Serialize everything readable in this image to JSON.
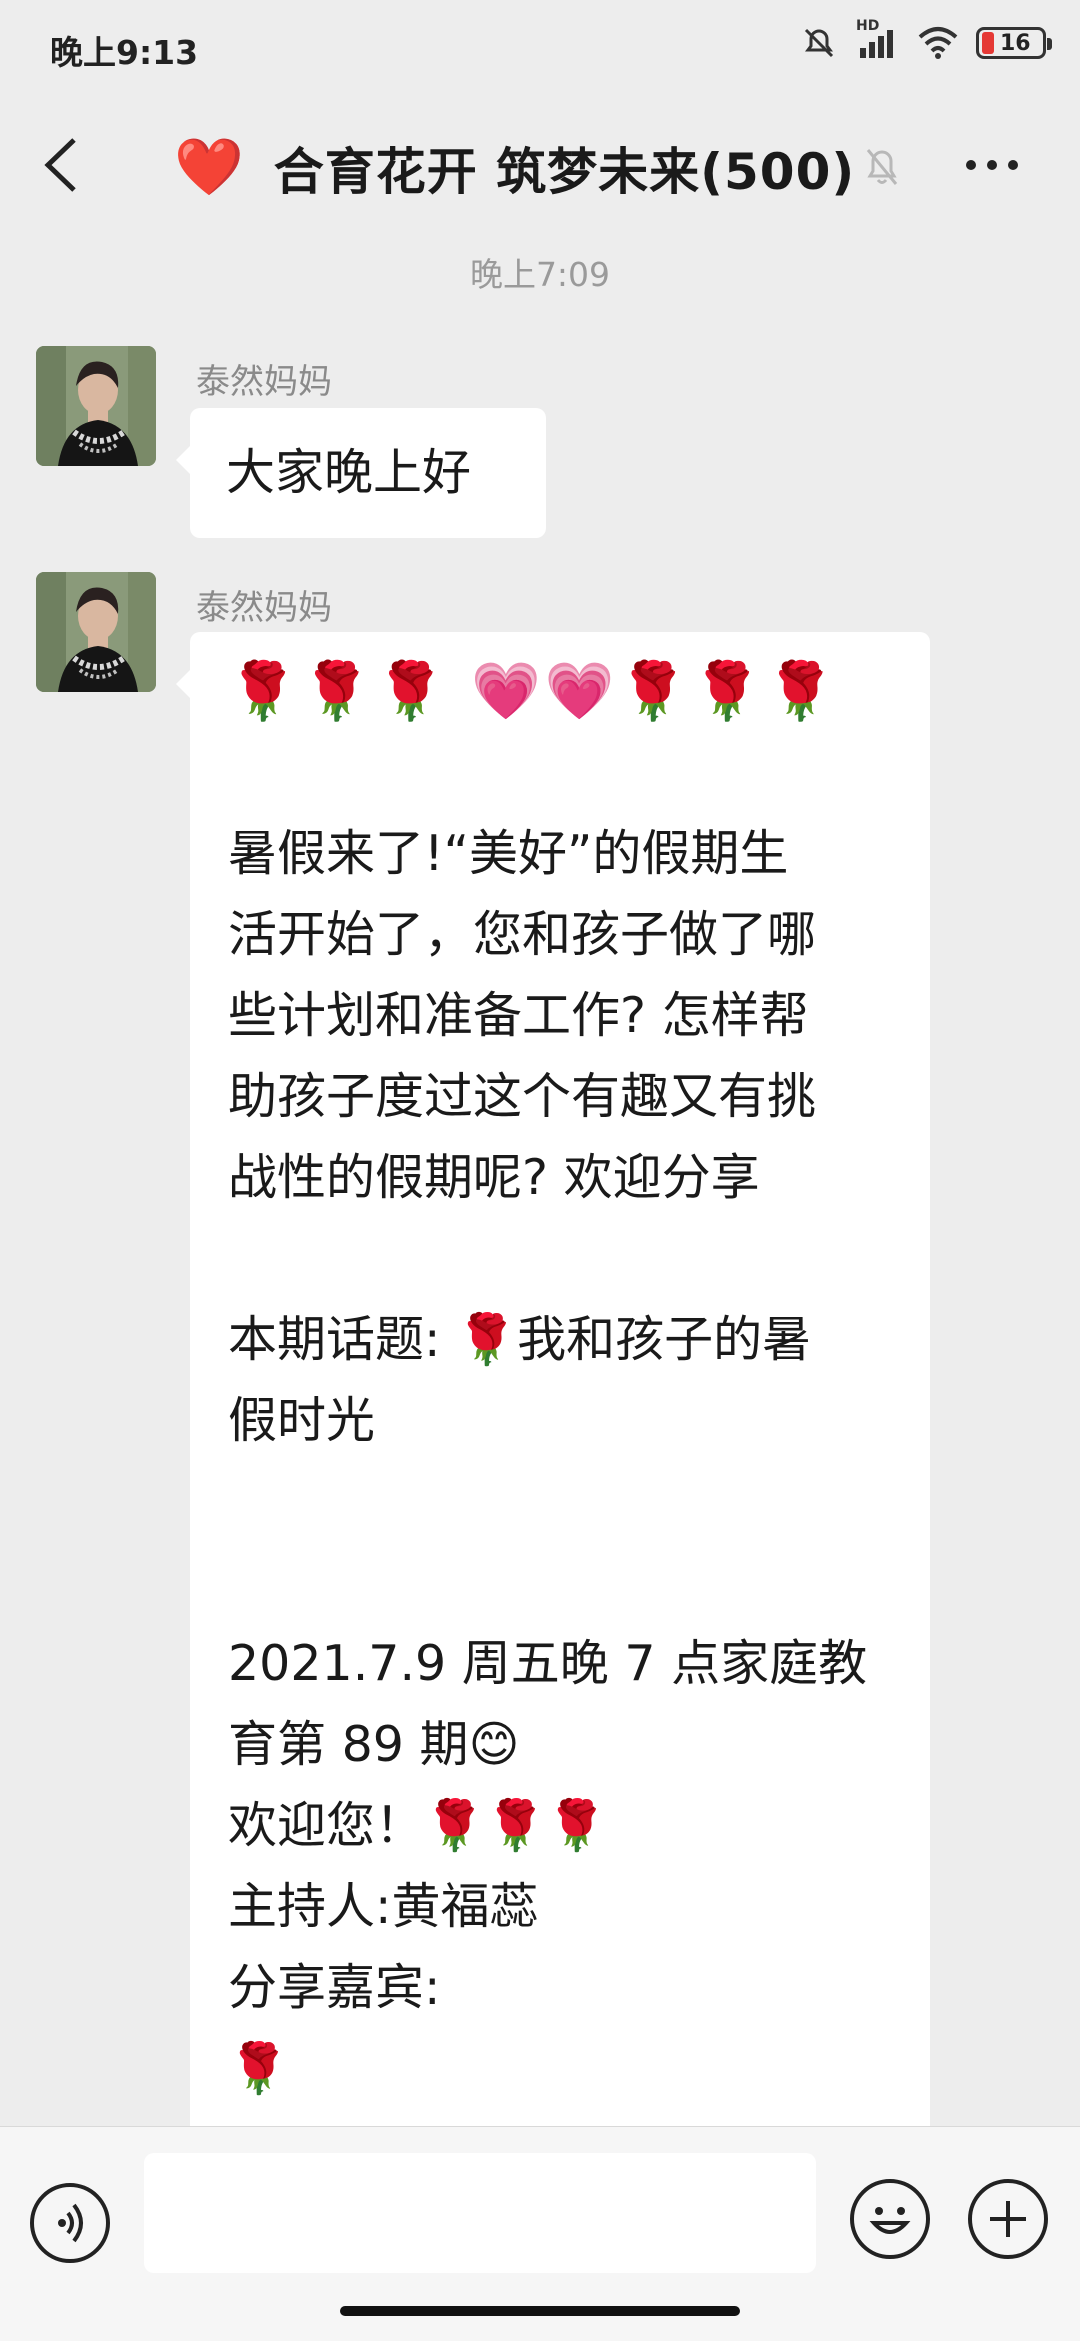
{
  "status_bar": {
    "time": "晚上9:13",
    "network_label": "HD",
    "battery_level": "16"
  },
  "header": {
    "title": "合育花开 筑梦未来(500)",
    "title_emoji": "❤️"
  },
  "timestamp": "晚上7:09",
  "messages": [
    {
      "sender": "泰然妈妈",
      "text": "大家晚上好"
    },
    {
      "sender": "泰然妈妈",
      "emoji_line": "🌹🌹🌹 💗💗🌹🌹🌹",
      "text": "\n暑假来了!“美好”的假期生\n活开始了，您和孩子做了哪\n些计划和准备工作? 怎样帮\n助孩子度过这个有趣又有挑\n战性的假期呢? 欢迎分享\n\n本期话题: 🌹我和孩子的暑\n假时光\n\n\n2021.7.9 周五晚 7 点家庭教\n育第 89 期😊\n欢迎您！🌹🌹🌹\n主持人:黄福蕊\n分享嘉宾:\n🌹"
    }
  ],
  "colors": {
    "background": "#ededed",
    "bubble": "#ffffff",
    "rose": "#c62828",
    "heart": "#f06292",
    "title_heart": "#e0182a"
  },
  "icons": [
    "back-icon",
    "mute-icon",
    "more-icon",
    "voice-icon",
    "emoji-icon",
    "add-icon",
    "wifi-icon",
    "signal-icon",
    "battery-icon"
  ]
}
